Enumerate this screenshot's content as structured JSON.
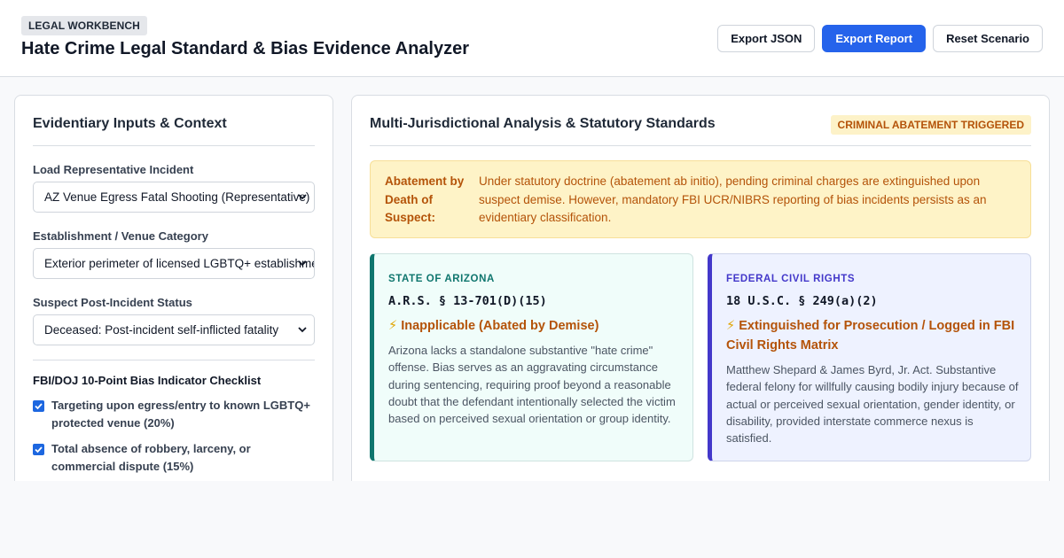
{
  "header": {
    "badge": "LEGAL WORKBENCH",
    "title": "Hate Crime Legal Standard & Bias Evidence Analyzer",
    "actions": {
      "export_json": "Export JSON",
      "export_report": "Export Report",
      "reset": "Reset Scenario"
    }
  },
  "colors": {
    "primary": "#2563eb",
    "warning_text": "#b45309",
    "warning_bg": "#fef3c7",
    "state_accent": "#0f766e",
    "federal_accent": "#4338ca"
  },
  "inputs_panel": {
    "title": "Evidentiary Inputs & Context",
    "incident": {
      "label": "Load Representative Incident",
      "selected": "AZ Venue Egress Fatal Shooting (Representative)"
    },
    "venue": {
      "label": "Establishment / Venue Category",
      "selected": "Exterior perimeter of licensed LGBTQ+ establishment"
    },
    "suspect_status": {
      "label": "Suspect Post-Incident Status",
      "selected": "Deceased: Post-incident self-inflicted fatality"
    },
    "checklist": {
      "title": "FBI/DOJ 10-Point Bias Indicator Checklist",
      "items": [
        {
          "label": "Targeting upon egress/entry to known LGBTQ+ protected venue (20%)",
          "checked": true
        },
        {
          "label": "Total absence of robbery, larceny, or commercial dispute (15%)",
          "checked": true
        }
      ]
    }
  },
  "analysis_panel": {
    "title": "Multi-Jurisdictional Analysis & Statutory Standards",
    "status_badge": "CRIMINAL ABATEMENT TRIGGERED",
    "alert": {
      "label": "Abatement by Death of Suspect:",
      "text": "Under statutory doctrine (abatement ab initio), pending criminal charges are extinguished upon suspect demise. However, mandatory FBI UCR/NIBRS reporting of bias incidents persists as an evidentiary classification."
    },
    "jurisdictions": [
      {
        "name": "STATE OF ARIZONA",
        "citation": "A.R.S. § 13-701(D)(15)",
        "icon": "lightning-icon",
        "verdict": "Inapplicable (Abated by Demise)",
        "description": "Arizona lacks a standalone substantive \"hate crime\" offense. Bias serves as an aggravating circumstance during sentencing, requiring proof beyond a reasonable doubt that the defendant intentionally selected the victim based on perceived sexual orientation or group identity."
      },
      {
        "name": "FEDERAL CIVIL RIGHTS",
        "citation": "18 U.S.C. § 249(a)(2)",
        "icon": "lightning-icon",
        "verdict": "Extinguished for Prosecution / Logged in FBI Civil Rights Matrix",
        "description": "Matthew Shepard & James Byrd, Jr. Act. Substantive federal felony for willfully causing bodily injury because of actual or perceived sexual orientation, gender identity, or disability, provided interstate commerce nexus is satisfied."
      }
    ]
  }
}
